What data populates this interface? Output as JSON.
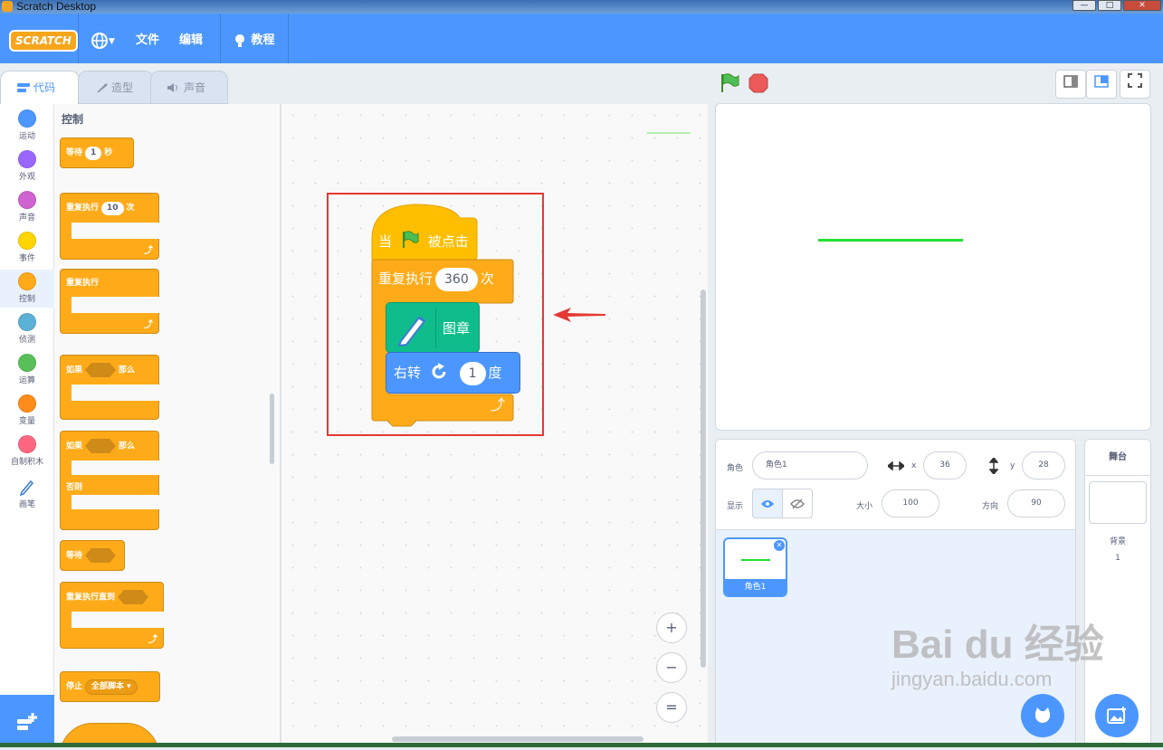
{
  "window": {
    "title": "Scratch Desktop",
    "buttons": [
      "—",
      "□",
      "✕"
    ]
  },
  "menubar": {
    "logo": "SCRATCH",
    "language_icon": "globe-icon",
    "file": "文件",
    "edit": "编辑",
    "tutorials": "教程"
  },
  "tabs": {
    "code": "代码",
    "costumes": "造型",
    "sounds": "声音"
  },
  "categories": [
    {
      "label": "运动",
      "color": "#4c97ff"
    },
    {
      "label": "外观",
      "color": "#9966ff"
    },
    {
      "label": "声音",
      "color": "#cf63cf"
    },
    {
      "label": "事件",
      "color": "#ffd500"
    },
    {
      "label": "控制",
      "color": "#ffab19"
    },
    {
      "label": "侦测",
      "color": "#5cb1d6"
    },
    {
      "label": "运算",
      "color": "#59c059"
    },
    {
      "label": "变量",
      "color": "#ff8c1a"
    },
    {
      "label": "自制积木",
      "color": "#ff6680"
    },
    {
      "label": "画笔",
      "color": "pen-icon"
    }
  ],
  "palette": {
    "title": "控制",
    "wait": {
      "text": "等待",
      "value": "1",
      "unit": "秒"
    },
    "repeat": {
      "text": "重复执行",
      "value": "10",
      "unit": "次"
    },
    "forever": {
      "text": "重复执行"
    },
    "if_then": {
      "if": "如果",
      "then": "那么"
    },
    "if_else": {
      "if": "如果",
      "then": "那么",
      "else": "否则"
    },
    "wait_until": {
      "text": "等待"
    },
    "repeat_until": {
      "text": "重复执行直到"
    },
    "stop": {
      "text": "停止",
      "option": "全部脚本"
    }
  },
  "script": {
    "hat": {
      "when": "当",
      "clicked": "被点击"
    },
    "repeat": {
      "text": "重复执行",
      "value": "360",
      "unit": "次"
    },
    "stamp": {
      "text": "图章"
    },
    "turn": {
      "text": "右转",
      "value": "1",
      "unit": "度"
    }
  },
  "zoom": {
    "in": "+",
    "out": "−",
    "reset": "="
  },
  "sprite_info": {
    "sprite_label": "角色",
    "sprite_name": "角色1",
    "x_label": "x",
    "x_value": "36",
    "y_label": "y",
    "y_value": "28",
    "show_label": "显示",
    "size_label": "大小",
    "size_value": "100",
    "direction_label": "方向",
    "direction_value": "90"
  },
  "sprites": [
    {
      "name": "角色1"
    }
  ],
  "stage_panel": {
    "title": "舞台",
    "backdrops_label": "背景",
    "backdrops_count": "1"
  },
  "watermark": {
    "line1": "Bai du 经验",
    "line2": "jingyan.baidu.com"
  },
  "colors": {
    "accent": "#4c97ff",
    "control": "#ffab19",
    "pen": "#0fbd8c",
    "motion": "#4c97ff",
    "annotation": "#e53935",
    "drawn_line": "#22e033"
  }
}
